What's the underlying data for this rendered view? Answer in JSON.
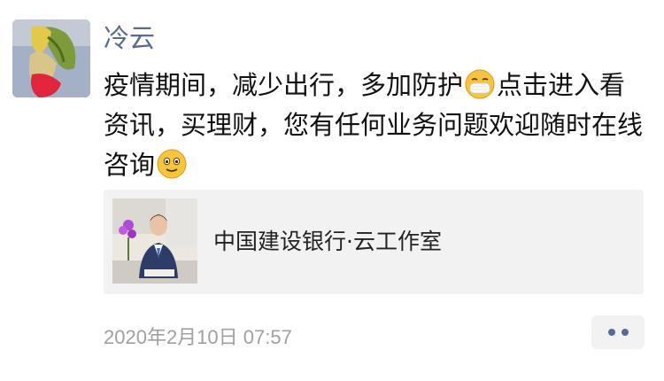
{
  "post": {
    "author_name": "冷云",
    "text_part1": "疫情期间，减少出行，多加防护",
    "emoji1": "mask-face-emoji",
    "text_part2": "点击进入看资讯，买理财，您有任何业务问题欢迎随时在线咨询",
    "emoji2": "smile-face-emoji",
    "timestamp": "2020年2月10日 07:57"
  },
  "share_card": {
    "title": "中国建设银行·云工作室",
    "thumbnail_icon": "bank-staff-photo"
  },
  "actions": {
    "more_icon": "two-dots-icon"
  },
  "colors": {
    "name_blue": "#576b95",
    "card_bg": "#f2f2f2",
    "timestamp_gray": "#a0a0a0"
  }
}
